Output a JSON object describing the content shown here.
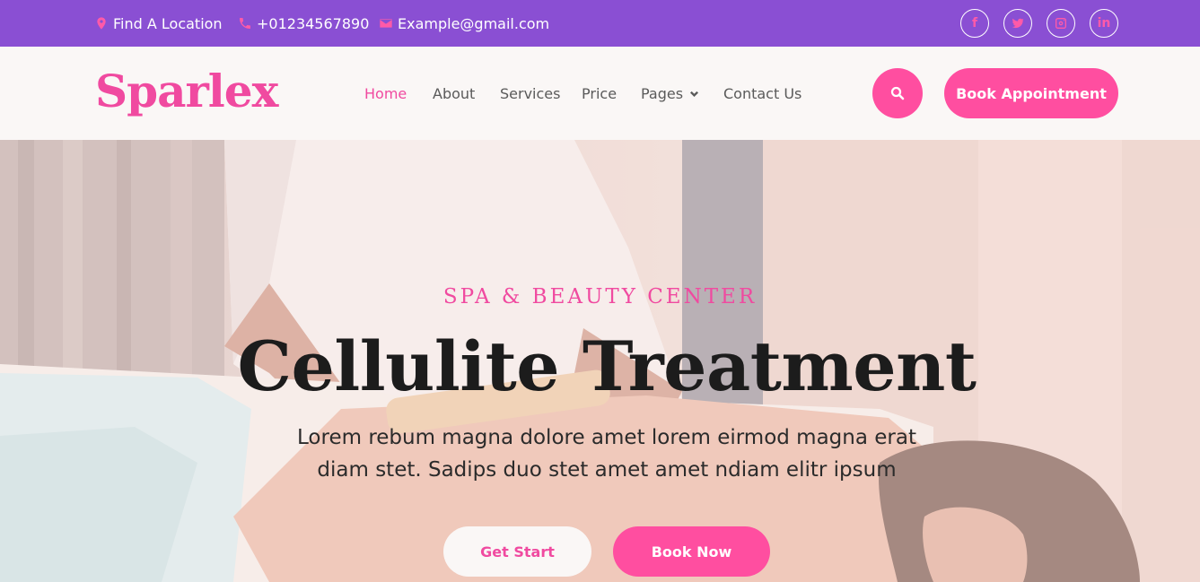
{
  "topbar": {
    "location": "Find A Location",
    "phone": "+01234567890",
    "email": "Example@gmail.com",
    "socials": [
      {
        "name": "facebook",
        "glyph": "f"
      },
      {
        "name": "twitter",
        "glyph": ""
      },
      {
        "name": "instagram",
        "glyph": ""
      },
      {
        "name": "linkedin",
        "glyph": "in"
      }
    ]
  },
  "brand": "Sparlex",
  "nav": {
    "items": [
      {
        "label": "Home",
        "active": true
      },
      {
        "label": "About"
      },
      {
        "label": "Services"
      },
      {
        "label": "Price"
      },
      {
        "label": "Pages",
        "dropdown": true
      },
      {
        "label": "Contact Us"
      }
    ],
    "book_label": "Book Appointment"
  },
  "hero": {
    "subtitle": "SPA & BEAUTY CENTER",
    "title": "Cellulite Treatment",
    "description_line1": "Lorem rebum magna dolore amet lorem eirmod magna erat",
    "description_line2": "diam stet. Sadips duo stet amet amet ndiam elitr ipsum",
    "primary_button": "Get Start",
    "secondary_button": "Book Now"
  },
  "colors": {
    "topbar_bg": "#8a4fd3",
    "accent": "#ff4ea0",
    "brand": "#f04aa0",
    "nav_bg": "#faf7f6",
    "title": "#1c1c1c"
  },
  "icons": {
    "location": "map-pin-icon",
    "phone": "phone-icon",
    "email": "envelope-icon",
    "search": "search-icon",
    "pages_dropdown": "chevron-down-icon"
  }
}
